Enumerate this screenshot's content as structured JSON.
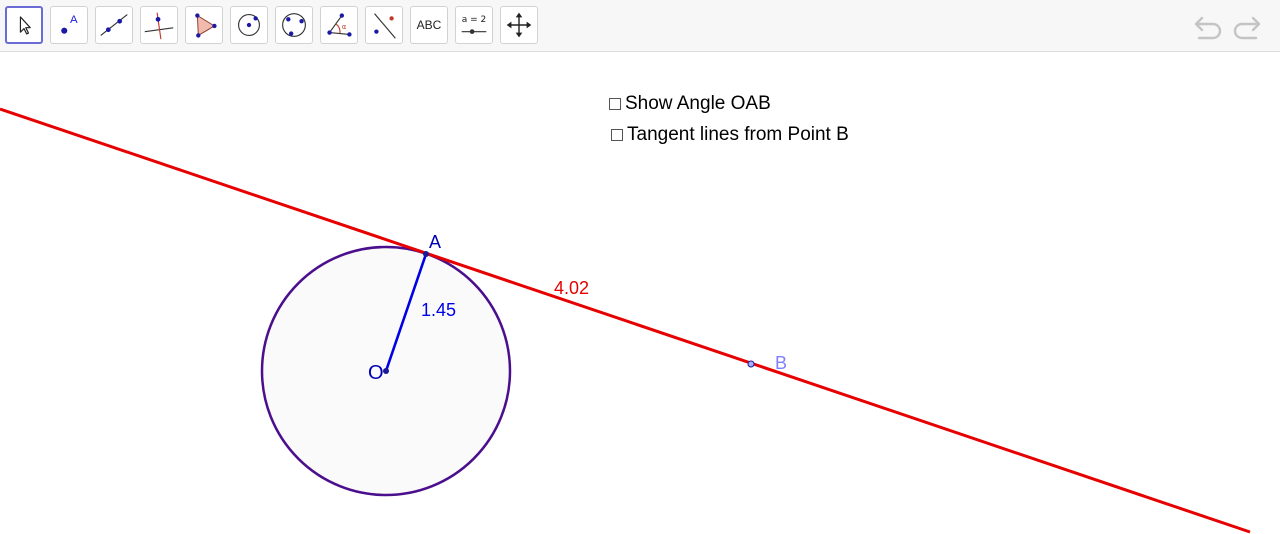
{
  "toolbar": {
    "tools": [
      {
        "id": "move",
        "icon": "arrow-cursor-icon",
        "selected": true
      },
      {
        "id": "point",
        "icon": "point-icon",
        "label": "A"
      },
      {
        "id": "line",
        "icon": "line-through-two-points-icon"
      },
      {
        "id": "perpendicular",
        "icon": "perpendicular-line-icon"
      },
      {
        "id": "polygon",
        "icon": "polygon-icon"
      },
      {
        "id": "circle-center-point",
        "icon": "circle-center-point-icon"
      },
      {
        "id": "circle-three-points",
        "icon": "circle-three-points-icon"
      },
      {
        "id": "angle",
        "icon": "angle-icon",
        "label": "α"
      },
      {
        "id": "reflect",
        "icon": "reflect-about-line-icon"
      },
      {
        "id": "text",
        "icon": "text-icon",
        "label": "ABC"
      },
      {
        "id": "slider",
        "icon": "slider-icon",
        "label": "a = 2"
      },
      {
        "id": "move-graphics",
        "icon": "move-graphics-view-icon"
      }
    ],
    "undo_icon": "undo-icon",
    "redo_icon": "redo-icon"
  },
  "checkboxes": [
    {
      "label": "Show Angle OAB",
      "checked": false
    },
    {
      "label": "Tangent lines from Point B",
      "checked": false
    }
  ],
  "construction": {
    "circle": {
      "center_label": "O",
      "radius_label": "1.45"
    },
    "point_a": {
      "label": "A"
    },
    "point_b": {
      "label": "B"
    },
    "segment_ab": {
      "length_label": "4.02"
    },
    "colors": {
      "circle_stroke": "#4b0e8c",
      "circle_fill": "#fafafa",
      "tangent_line": "#e60000",
      "radius": "#0000e6",
      "point_b_label": "#8080ff",
      "segment_label": "#e60000"
    }
  }
}
